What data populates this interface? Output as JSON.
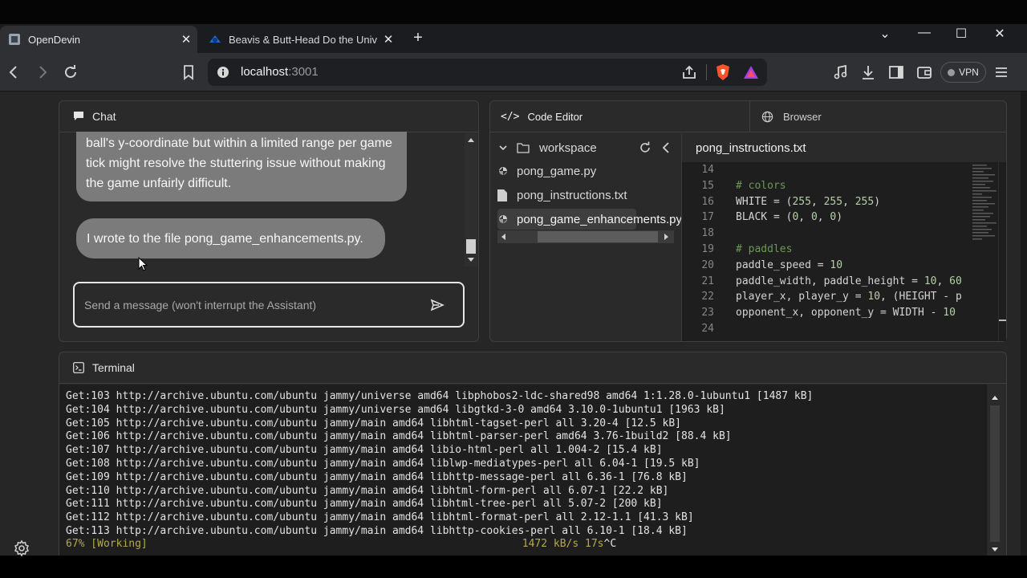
{
  "browser": {
    "tabs": [
      {
        "title": "OpenDevin",
        "close": "✕"
      },
      {
        "title": "Beavis & Butt-Head Do the Universe",
        "close": "✕"
      }
    ],
    "new_tab": "+",
    "window_controls": {
      "minimize": "—",
      "maximize": "☐",
      "close": "✕",
      "dropdown": "⌄"
    },
    "address": {
      "host": "localhost",
      "port": ":3001"
    },
    "vpn_label": "VPN"
  },
  "chat": {
    "title": "Chat",
    "messages": [
      "ball's y-coordinate but within a limited range per game tick might resolve the stuttering issue without making the game unfairly difficult.",
      "I wrote to the file pong_game_enhancements.py."
    ],
    "input_placeholder": "Send a message (won't interrupt the Assistant)"
  },
  "editor": {
    "tabs": {
      "code": "Code Editor",
      "browser": "Browser"
    },
    "workspace_label": "workspace",
    "files": [
      "pong_game.py",
      "pong_instructions.txt",
      "pong_game_enhancements.py"
    ],
    "open_file": "pong_instructions.txt",
    "code_lines": [
      {
        "n": "14",
        "text": ""
      },
      {
        "n": "15",
        "text": "# colors"
      },
      {
        "n": "16",
        "text": "WHITE = (255, 255, 255)"
      },
      {
        "n": "17",
        "text": "BLACK = (0, 0, 0)"
      },
      {
        "n": "18",
        "text": ""
      },
      {
        "n": "19",
        "text": "# paddles"
      },
      {
        "n": "20",
        "text": "paddle_speed = 10"
      },
      {
        "n": "21",
        "text": "paddle_width, paddle_height = 10, 60"
      },
      {
        "n": "22",
        "text": "player_x, player_y = 10, (HEIGHT - p"
      },
      {
        "n": "23",
        "text": "opponent_x, opponent_y = WIDTH - 10"
      },
      {
        "n": "24",
        "text": ""
      }
    ]
  },
  "terminal": {
    "title": "Terminal",
    "lines": [
      "Get:103 http://archive.ubuntu.com/ubuntu jammy/universe amd64 libphobos2-ldc-shared98 amd64 1:1.28.0-1ubuntu1 [1487 kB]",
      "Get:104 http://archive.ubuntu.com/ubuntu jammy/universe amd64 libgtkd-3-0 amd64 3.10.0-1ubuntu1 [1963 kB]",
      "Get:105 http://archive.ubuntu.com/ubuntu jammy/main amd64 libhtml-tagset-perl all 3.20-4 [12.5 kB]",
      "Get:106 http://archive.ubuntu.com/ubuntu jammy/main amd64 libhtml-parser-perl amd64 3.76-1build2 [88.4 kB]",
      "Get:107 http://archive.ubuntu.com/ubuntu jammy/main amd64 libio-html-perl all 1.004-2 [15.4 kB]",
      "Get:108 http://archive.ubuntu.com/ubuntu jammy/main amd64 liblwp-mediatypes-perl all 6.04-1 [19.5 kB]",
      "Get:109 http://archive.ubuntu.com/ubuntu jammy/main amd64 libhttp-message-perl all 6.36-1 [76.8 kB]",
      "Get:110 http://archive.ubuntu.com/ubuntu jammy/main amd64 libhtml-form-perl all 6.07-1 [22.2 kB]",
      "Get:111 http://archive.ubuntu.com/ubuntu jammy/main amd64 libhtml-tree-perl all 5.07-2 [200 kB]",
      "Get:112 http://archive.ubuntu.com/ubuntu jammy/main amd64 libhtml-format-perl all 2.12-1.1 [41.3 kB]",
      "Get:113 http://archive.ubuntu.com/ubuntu jammy/main amd64 libhttp-cookies-perl all 6.10-1 [18.4 kB]"
    ],
    "status_progress": "67% [Working]",
    "status_rate": "1472 kB/s 17s",
    "status_interrupt": "^C"
  },
  "colors": {
    "status_yellow": "#b5a94a",
    "comment_green": "#6a9955",
    "number_green": "#b5cea8"
  }
}
